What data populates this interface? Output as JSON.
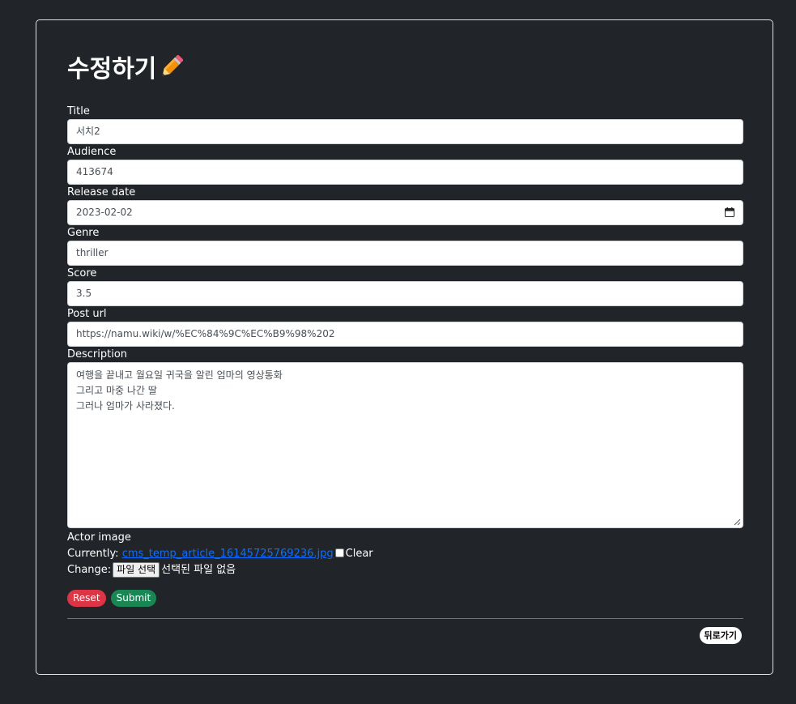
{
  "page": {
    "title": "수정하기",
    "title_icon": "pencil-icon"
  },
  "form": {
    "title": {
      "label": "Title",
      "value": "서치2"
    },
    "audience": {
      "label": "Audience",
      "value": "413674"
    },
    "release_date": {
      "label": "Release date",
      "value": "2023-02-02",
      "icon": "calendar-icon"
    },
    "genre": {
      "label": "Genre",
      "value": "thriller"
    },
    "score": {
      "label": "Score",
      "value": "3.5"
    },
    "post_url": {
      "label": "Post url",
      "value": "https://namu.wiki/w/%EC%84%9C%EC%B9%98%202"
    },
    "description": {
      "label": "Description",
      "lines": [
        "여행을 끝내고 월요일 귀국을 알린 엄마의 영상통화",
        "그리고 마중 나간 딸",
        "그러나 엄마가 사라졌다."
      ]
    },
    "actor_image": {
      "label": "Actor image",
      "currently_label": "Currently:",
      "current_file": "cms_temp_article_16145725769236.jpg",
      "clear_label": "Clear",
      "change_label": "Change:",
      "file_button": "파일 선택",
      "file_status": "선택된 파일 없음"
    }
  },
  "buttons": {
    "reset": "Reset",
    "submit": "Submit",
    "back": "뒤로가기"
  },
  "colors": {
    "background": "#212529",
    "reset": "#dc3545",
    "submit": "#198754",
    "link": "#0d6efd"
  }
}
